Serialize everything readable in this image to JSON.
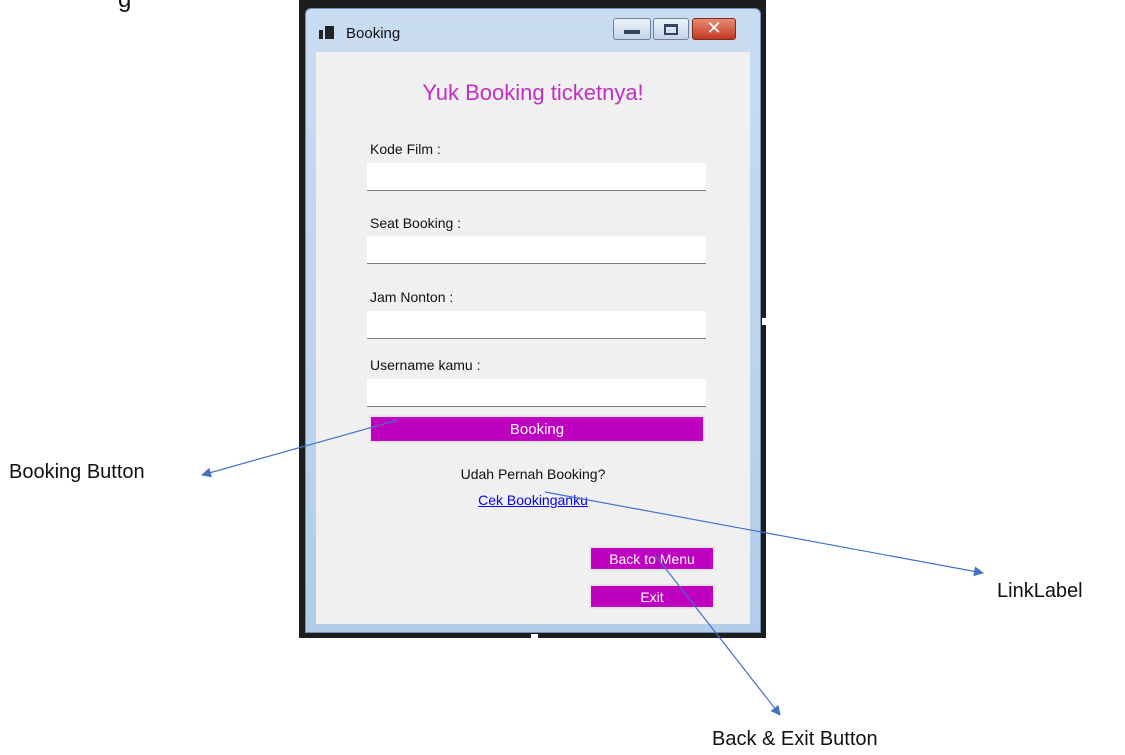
{
  "top_fragment": "g",
  "window": {
    "title": "Booking",
    "heading": "Yuk Booking ticketnya!",
    "fields": [
      {
        "label": "Kode Film :",
        "value": "",
        "placeholder": ""
      },
      {
        "label": "Seat Booking :",
        "value": "",
        "placeholder": ""
      },
      {
        "label": "Jam Nonton :",
        "value": "",
        "placeholder": ""
      },
      {
        "label": "Username kamu :",
        "value": "",
        "placeholder": ""
      }
    ],
    "booking_button": "Booking",
    "question": "Udah Pernah Booking?",
    "link": "Cek Bookinganku",
    "back_button": "Back to Menu",
    "exit_button": "Exit",
    "colors": {
      "accent": "#c000c0",
      "heading": "#c42ec4",
      "link": "#0000ff"
    }
  },
  "annotations": {
    "booking_button": "Booking Button",
    "linklabel": "LinkLabel",
    "back_exit": "Back & Exit Button"
  }
}
